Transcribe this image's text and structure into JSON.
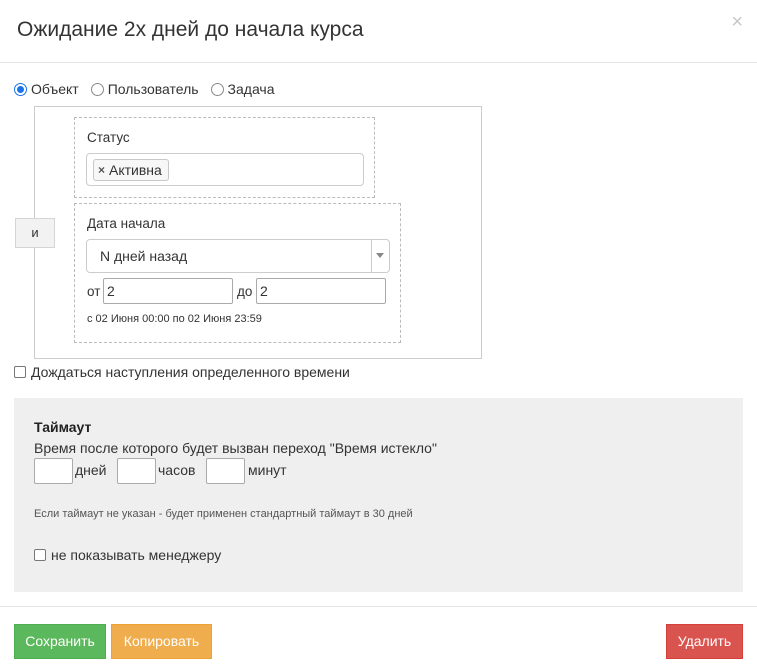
{
  "header": {
    "title": "Ожидание 2х дней до начала курса",
    "close_symbol": "×"
  },
  "scope_radios": [
    {
      "label": "Объект",
      "checked": true
    },
    {
      "label": "Пользователь",
      "checked": false
    },
    {
      "label": "Задача",
      "checked": false
    }
  ],
  "condition": {
    "operator_label": "и",
    "status": {
      "label": "Статус",
      "tags": [
        {
          "label": "Активна",
          "remove_symbol": "×"
        }
      ]
    },
    "start_date": {
      "label": "Дата начала",
      "mode_selected": "N дней назад",
      "from_label": "от",
      "from_value": "2",
      "to_label": "до",
      "to_value": "2",
      "range_hint": "с 02 Июня 00:00 по 02 Июня 23:59"
    }
  },
  "wait_time_checkbox": {
    "label": "Дождаться наступления определенного времени",
    "checked": false
  },
  "timeout": {
    "title": "Таймаут",
    "description": "Время после которого будет вызван переход \"Время истекло\"",
    "days_label": "дней",
    "hours_label": "часов",
    "minutes_label": "минут",
    "days_value": "",
    "hours_value": "",
    "minutes_value": "",
    "note": "Если таймаут не указан - будет применен стандартный таймаут в 30 дней",
    "hide_from_manager_label": "не показывать менеджеру",
    "hide_from_manager_checked": false
  },
  "footer": {
    "save_label": "Сохранить",
    "copy_label": "Копировать",
    "delete_label": "Удалить"
  },
  "colors": {
    "save": "#5cb85c",
    "copy": "#f0ad4e",
    "delete": "#d9534f",
    "radio_checked": "#1a73e8",
    "panel_bg": "#efefef"
  }
}
